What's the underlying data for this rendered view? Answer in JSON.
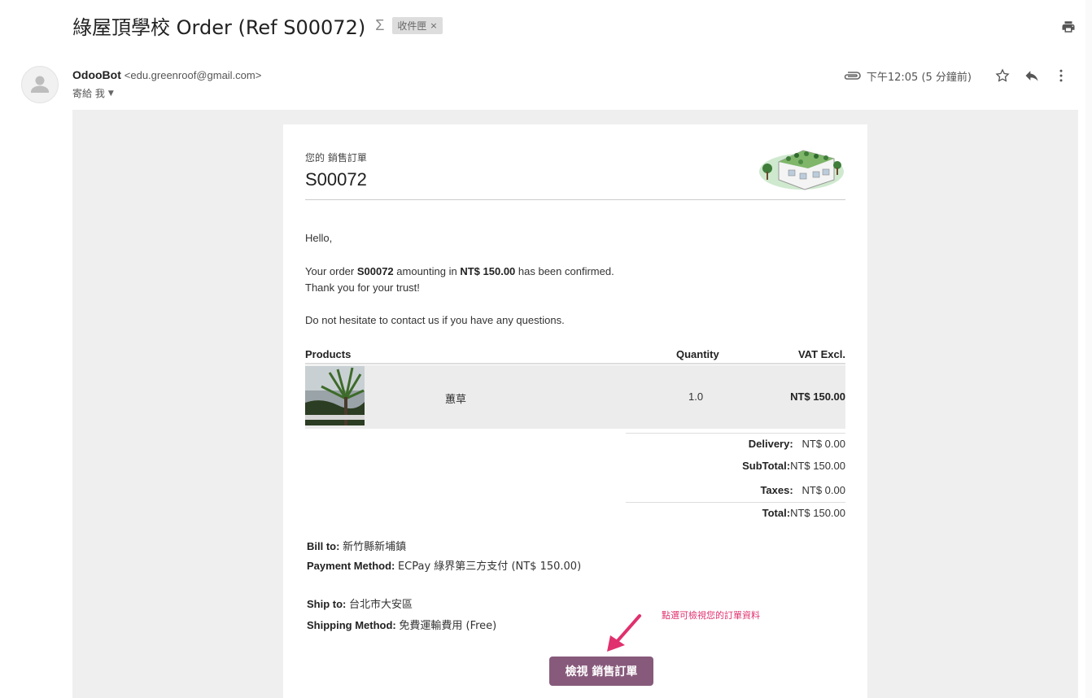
{
  "email": {
    "subject": "綠屋頂學校 Order (Ref S00072)",
    "important_marker": "Σ",
    "label": "收件匣",
    "label_remove": "×",
    "sender_name": "OdooBot",
    "sender_email": "<edu.greenroof@gmail.com>",
    "recipient": "寄給 我",
    "recipient_caret": "▼",
    "time": "下午12:05 (5 分鐘前)"
  },
  "icons": {
    "print": "print-icon",
    "attachment": "attachment-icon",
    "star": "star-icon",
    "reply": "reply-icon",
    "more": "more-vert-icon",
    "avatar": "person-icon"
  },
  "order": {
    "doc_label": "您的 銷售訂單",
    "number": "S00072",
    "greeting": "Hello,",
    "confirm_prefix": "Your order ",
    "confirm_ref": "S00072",
    "confirm_mid": " amounting in ",
    "confirm_amount": "NT$ 150.00",
    "confirm_suffix": " has been confirmed.",
    "thanks": "Thank you for your trust!",
    "contact": "Do not hesitate to contact us if you have any questions."
  },
  "table": {
    "headers": [
      "Products",
      "Quantity",
      "VAT Excl."
    ],
    "rows": [
      {
        "name": "蕙草",
        "quantity": "1.0",
        "price": "NT$ 150.00"
      }
    ]
  },
  "totals": {
    "delivery_label": "Delivery:",
    "delivery_value": "NT$ 0.00",
    "subtotal_label": "SubTotal:",
    "subtotal_value": "NT$ 150.00",
    "taxes_label": "Taxes:",
    "taxes_value": "NT$ 0.00",
    "total_label": "Total:",
    "total_value": "NT$ 150.00"
  },
  "billing": {
    "bill_to_label": "Bill to:",
    "bill_to_value": "新竹縣新埔鎮",
    "payment_label": "Payment Method:",
    "payment_value": "ECPay 綠界第三方支付 (NT$ 150.00)",
    "ship_to_label": "Ship to:",
    "ship_to_value": "台北市大安區",
    "shipping_label": "Shipping Method:",
    "shipping_value": "免費運輸費用 (Free)"
  },
  "annotation": {
    "hint": "點選可檢視您的訂單資料",
    "color": "#e0306e"
  },
  "button": {
    "label": "檢視 銷售訂單",
    "color": "#875a7b"
  }
}
